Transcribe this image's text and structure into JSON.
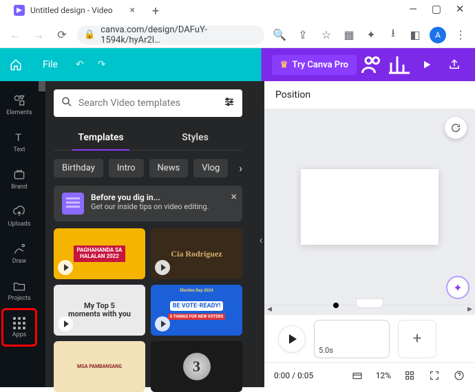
{
  "browser": {
    "tab_title": "Untitled design - Video",
    "url": "canva.com/design/DAFuY-1594k/hyAr2l…",
    "avatar_initial": "A"
  },
  "canva_bar": {
    "file": "File",
    "try_pro": "Try Canva Pro"
  },
  "left_rail": {
    "elements": "Elements",
    "text": "Text",
    "brand": "Brand",
    "uploads": "Uploads",
    "draw": "Draw",
    "projects": "Projects",
    "apps": "Apps"
  },
  "side_panel": {
    "search_placeholder": "Search Video templates",
    "tabs": {
      "templates": "Templates",
      "styles": "Styles"
    },
    "chips": [
      "Birthday",
      "Intro",
      "News",
      "Vlog"
    ],
    "tip": {
      "title": "Before you dig in...",
      "subtitle": "Get our inside tips on video editing."
    },
    "thumbs": {
      "t1a": "PAGHAHANDA SA",
      "t1b": "HALALAN 2022",
      "t2": "Cia Rodriguez",
      "t3a": "My Top 5",
      "t3b": "moments with you",
      "t4_top": "Election Day 2024",
      "t4": "BE VOTE-READY!",
      "t4b": "5 THINGS FOR NEW VOTERS",
      "t5a": "MGA PAMBANSANG",
      "t6": "3"
    }
  },
  "canvas": {
    "position": "Position",
    "clip_duration": "5.0s"
  },
  "status": {
    "time": "0:00 / 0:05",
    "zoom": "12%"
  }
}
